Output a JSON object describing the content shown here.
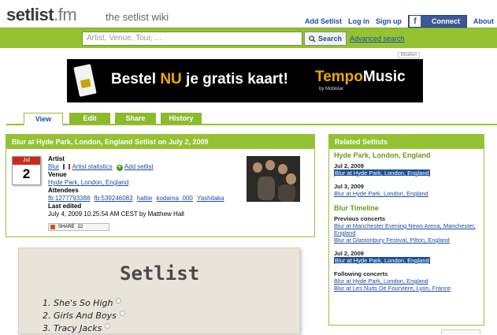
{
  "header": {
    "logo": "setlist",
    "logo_suffix": ".fm",
    "tagline": "the setlist wiki",
    "links": [
      "Add Setlist",
      "Log in",
      "Sign up"
    ],
    "facebook_connect": "Connect",
    "about": "About"
  },
  "search": {
    "placeholder": "Artist, Venue, Tour, ...",
    "button": "Search",
    "advanced": "Advanced search"
  },
  "ad": {
    "label": "Bloeker",
    "text_pre": "Bestel ",
    "text_highlight": "NU",
    "text_post": " je gratis kaart!",
    "brand_a": "Tempo",
    "brand_b": "Music",
    "brand_sub": "by Mobistar"
  },
  "tabs": [
    "View",
    "Edit",
    "Share",
    "History"
  ],
  "setlist": {
    "title": "Blur at Hyde Park, London, England Setlist on July 2, 2009",
    "cal_month": "Jul",
    "cal_day": "2",
    "artist_label": "Artist",
    "artist": "Blur",
    "artist_stats": "Artist statistics",
    "add_setlist": "Add setlist",
    "venue_label": "Venue",
    "venue": "Hyde Park, London, England",
    "attendees_label": "Attendees",
    "attendees": [
      "fb:1277793388",
      "fb:539246083",
      "hattie",
      "kodama_000",
      "Yashitaka"
    ],
    "last_edited_label": "Last edited",
    "last_edited": "July 4, 2009 10:25:54 AM CEST by Matthew Hall",
    "share_label": "SHARE",
    "share_count": "22"
  },
  "paper": {
    "title": "Setlist",
    "songs": [
      "She's So High",
      "Girls And Boys",
      "Tracy Jacks"
    ]
  },
  "related": {
    "heading": "Related Setlists",
    "venue_title": "Hyde Park, London, England",
    "venue_entries": [
      {
        "date": "Jul 2, 2009",
        "link": "Blur at Hyde Park, London, England"
      },
      {
        "date": "Jul 3, 2009",
        "link": "Blur at Hyde Park, London, England"
      }
    ],
    "timeline_title": "Blur Timeline",
    "previous_label": "Previous concerts",
    "previous": [
      "Blur at Manchester Evening News Arena, Manchester, England",
      "Blur at Glastonbury Festival, Pilton, England"
    ],
    "current_date": "Jul 2, 2009",
    "current_link": "Blur at Hyde Park, London, England",
    "following_label": "Following concerts",
    "following": [
      "Blur at Hyde Park, London, England",
      "Blur at Les Nuits De Fourviere, Lyon, France"
    ]
  },
  "colors": {
    "accent_green": "#95c233",
    "link_blue": "#1a4e9e",
    "facebook_blue": "#3b5998",
    "calendar_red": "#c82b1e",
    "ad_orange": "#f0a800"
  }
}
